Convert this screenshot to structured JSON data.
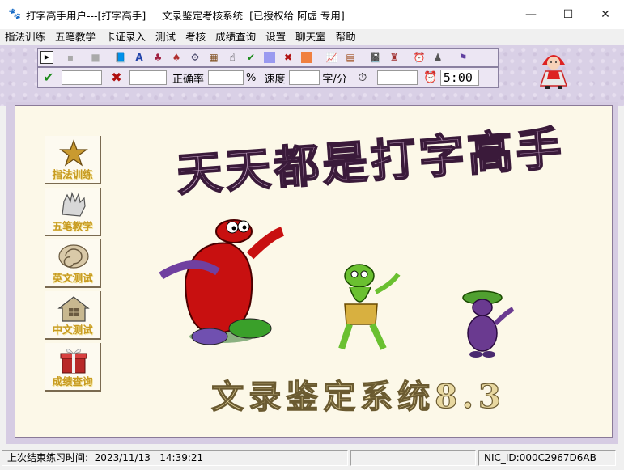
{
  "window": {
    "title": "打字高手用户---[打字高手]     文录鉴定考核系统  [已授权给 阿虚 专用]",
    "app_icon": "paw-icon",
    "controls": {
      "minimize": "—",
      "maximize": "☐",
      "close": "✕"
    }
  },
  "menu": [
    "指法训练",
    "五笔教学",
    "卡证录入",
    "测试",
    "考核",
    "成绩查询",
    "设置",
    "聊天室",
    "帮助"
  ],
  "toolbar": {
    "buttons": [
      "play-icon",
      "pause-icon",
      "stop-icon",
      "book-icon",
      "font-icon",
      "ink-icon",
      "cup-icon",
      "gear-icon",
      "film-icon",
      "hand-icon",
      "check-icon",
      "square-blue-icon",
      "cross-icon",
      "square-orange-icon",
      "chart-icon",
      "grid-icon",
      "notebook-icon",
      "robot-icon",
      "alarm-icon",
      "user-icon",
      "flag-icon"
    ]
  },
  "stats": {
    "accuracy_label": "正确率",
    "percent": "%",
    "speed_label": "速度",
    "speed_unit": "字/分",
    "time_value": "5:00"
  },
  "headline": "天天都是打字高手",
  "subtitle": "文录鉴定系统8.3",
  "sidebar": [
    {
      "label": "指法训练",
      "icon": "star-icon"
    },
    {
      "label": "五笔教学",
      "icon": "glove-icon"
    },
    {
      "label": "英文测试",
      "icon": "shell-icon"
    },
    {
      "label": "中文测试",
      "icon": "house-icon"
    },
    {
      "label": "成绩查询",
      "icon": "gift-icon"
    }
  ],
  "status": {
    "last_practice": "上次结束练习时间:  2023/11/13   14:39:21",
    "nic_id": "NIC_ID:000C2967D6AB"
  },
  "colors": {
    "tool_bg": "#d9d0e6",
    "canvas_bg": "#fcf8e8",
    "headline_fill": "#c9a8c8",
    "label_gold": "#c79a20"
  }
}
